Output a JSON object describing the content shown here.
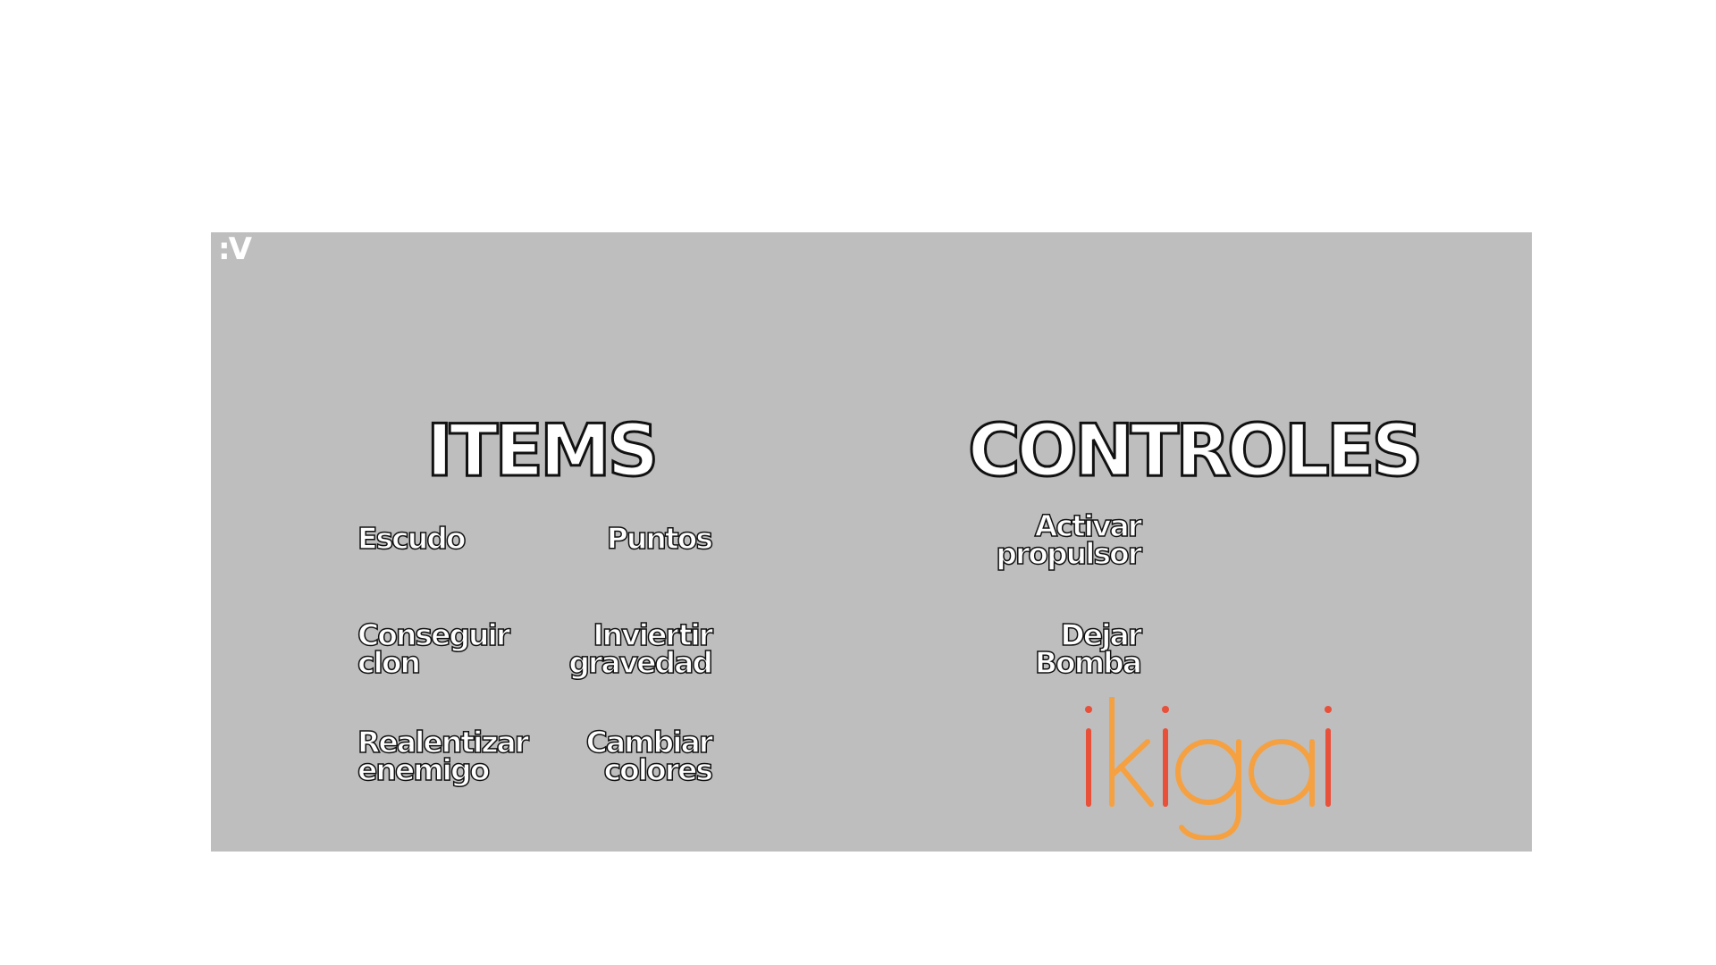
{
  "nav": {
    "back_label": ":V"
  },
  "sections": {
    "items_title": "ITEMS",
    "controls_title": "CONTROLES"
  },
  "items": [
    "Escudo",
    "Puntos",
    "Conseguir\nclon",
    "Inviertir\ngravedad",
    "Realentizar\nenemigo",
    "Cambiar\ncolores"
  ],
  "controls": [
    "Activar\npropulsor",
    "Dejar\nBomba"
  ],
  "logo": {
    "text": "ikigai",
    "colors": {
      "red": "#e8503a",
      "orange": "#f5a142"
    }
  },
  "colors": {
    "panel": "#bebebe",
    "text_fill": "#ffffff",
    "text_outline": "#111111"
  }
}
